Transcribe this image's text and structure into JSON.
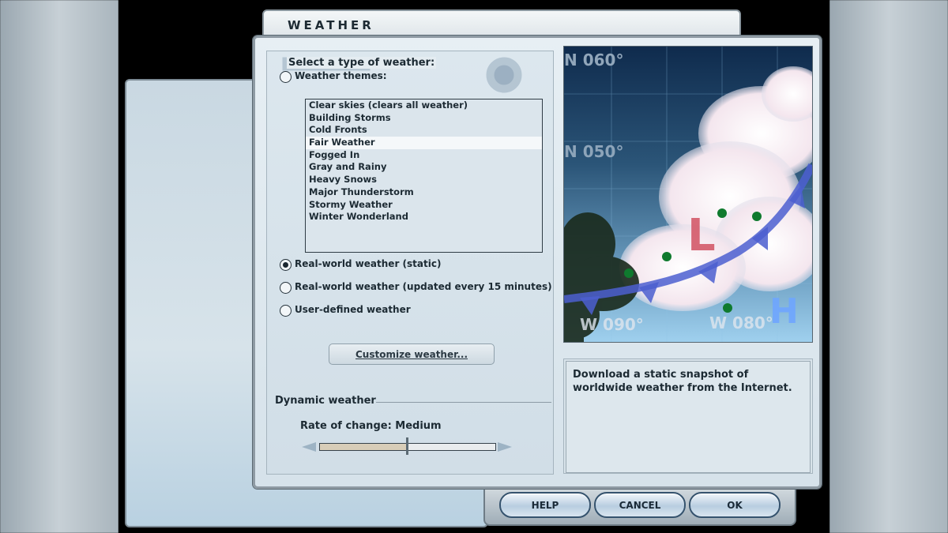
{
  "window": {
    "title": "WEATHER"
  },
  "weather_type": {
    "heading": "Select a type of weather:",
    "options": [
      {
        "label": "Weather themes:",
        "checked": false
      },
      {
        "label": "Real-world weather (static)",
        "checked": true
      },
      {
        "label": "Real-world weather (updated every 15 minutes)",
        "checked": false
      },
      {
        "label": "User-defined weather",
        "checked": false
      }
    ],
    "themes": [
      "Clear skies (clears all weather)",
      "Building Storms",
      "Cold Fronts",
      "Fair Weather",
      "Fogged In",
      "Gray and Rainy",
      "Heavy Snows",
      "Major Thunderstorm",
      "Stormy Weather",
      "Winter Wonderland"
    ],
    "selected_theme": "Fair Weather",
    "customize_button": "Customize weather..."
  },
  "dynamic": {
    "heading": "Dynamic weather",
    "rate_label": "Rate of change: Medium",
    "rate_value": 0.5
  },
  "image": {
    "labels": [
      "N 060°",
      "N 050°",
      "W 090°",
      "W 080°",
      "L",
      "H"
    ]
  },
  "description": "Download a static snapshot of worldwide weather from the Internet.",
  "footer": {
    "help": "HELP",
    "cancel": "CANCEL",
    "ok": "OK"
  },
  "colors": {
    "low_marker": "#d45a6a",
    "high_marker": "#6fa6ff",
    "front_line": "#4c5fd0",
    "station_dot": "#0f7a2e"
  }
}
